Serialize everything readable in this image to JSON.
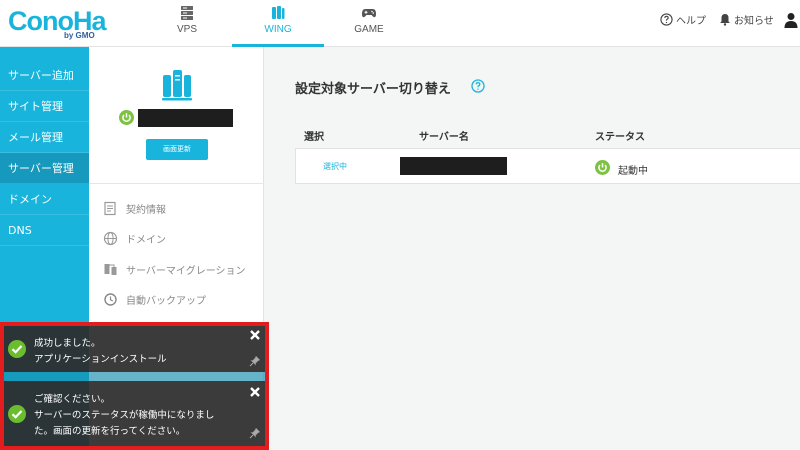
{
  "brand": {
    "logo": "ConoHa",
    "logo_sub": "by GMO"
  },
  "tabs": [
    {
      "label": "VPS",
      "icon": "server-rack-icon"
    },
    {
      "label": "WING",
      "icon": "wing-server-icon",
      "active": true
    },
    {
      "label": "GAME",
      "icon": "gamepad-icon"
    }
  ],
  "header": {
    "help": "ヘルプ",
    "notice": "お知らせ"
  },
  "sidebar": {
    "items": [
      {
        "label": "サーバー追加"
      },
      {
        "label": "サイト管理"
      },
      {
        "label": "メール管理"
      },
      {
        "label": "サーバー管理",
        "active": true
      },
      {
        "label": "ドメイン"
      },
      {
        "label": "DNS"
      }
    ]
  },
  "server_panel": {
    "refresh_label": "画面更新",
    "menu": [
      {
        "label": "契約情報",
        "icon": "contract-icon"
      },
      {
        "label": "ドメイン",
        "icon": "globe-icon"
      },
      {
        "label": "サーバーマイグレーション",
        "icon": "migration-icon"
      },
      {
        "label": "自動バックアップ",
        "icon": "backup-clock-icon"
      }
    ]
  },
  "main": {
    "title": "設定対象サーバー切り替え",
    "table": {
      "headers": [
        "選択",
        "サーバー名",
        "ステータス"
      ],
      "rows": [
        {
          "select": "選択中",
          "status": "起動中"
        }
      ]
    }
  },
  "toasts": [
    {
      "lines": [
        "成功しました。",
        "アプリケーションインストール"
      ]
    },
    {
      "lines": [
        "ご確認ください。",
        "サーバーのステータスが稼働中になりまし",
        "た。画面の更新を行ってください。"
      ]
    }
  ],
  "colors": {
    "accent": "#19b4dc",
    "accent_dark": "#1699bc",
    "success": "#7dc242",
    "highlight_frame": "#e31d1d"
  }
}
